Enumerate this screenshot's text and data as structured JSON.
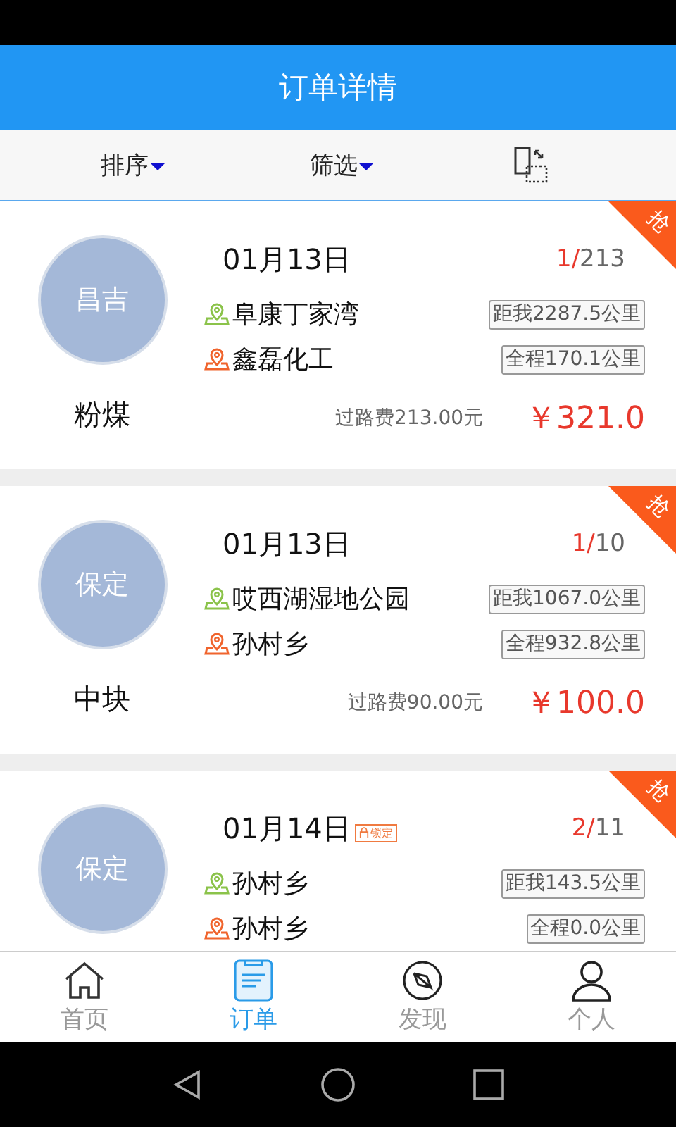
{
  "header": {
    "title": "订单详情"
  },
  "toolbar": {
    "sort": "排序",
    "filter": "筛选"
  },
  "orders": [
    {
      "city": "昌吉",
      "cargo": "粉煤",
      "date": "01月13日",
      "count": "1/",
      "total": "213",
      "from": "阜康丁家湾",
      "to": "鑫磊化工",
      "distance": "距我2287.5公里",
      "route": "全程170.1公里",
      "toll": "过路费213.00元",
      "price": "￥321.0",
      "ribbon": "抢"
    },
    {
      "city": "保定",
      "cargo": "中块",
      "date": "01月13日",
      "count": "1/",
      "total": "10",
      "from": "哎西湖湿地公园",
      "to": "孙村乡",
      "distance": "距我1067.0公里",
      "route": "全程932.8公里",
      "toll": "过路费90.00元",
      "price": "￥100.0",
      "ribbon": "抢"
    },
    {
      "city": "保定",
      "date": "01月14日",
      "lock": "锁定",
      "count": "2/",
      "total": "11",
      "from": "孙村乡",
      "to": "孙村乡",
      "distance": "距我143.5公里",
      "route": "全程0.0公里",
      "ribbon": "抢"
    }
  ],
  "tabs": [
    {
      "label": "首页",
      "kind": "home",
      "selected": false
    },
    {
      "label": "订单",
      "kind": "order",
      "selected": true
    },
    {
      "label": "发现",
      "kind": "compass",
      "selected": false
    },
    {
      "label": "个人",
      "kind": "person",
      "selected": false
    }
  ]
}
